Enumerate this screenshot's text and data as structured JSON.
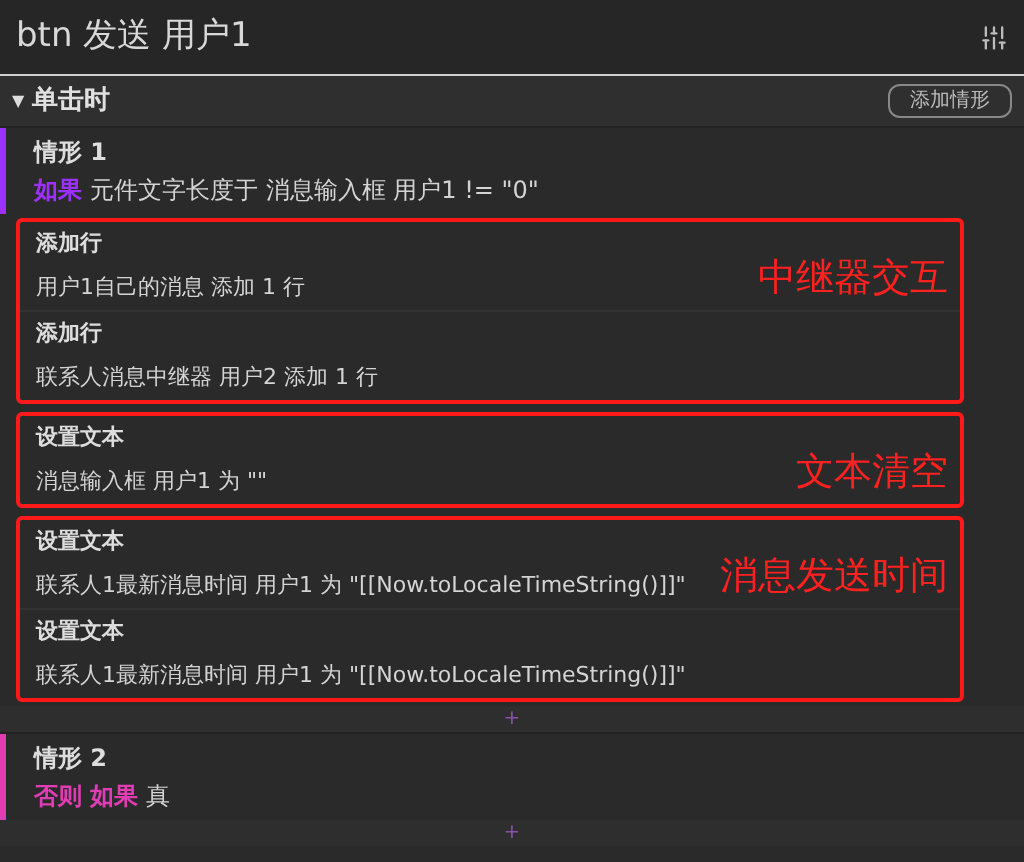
{
  "title": "btn 发送 用户1",
  "event": {
    "toggle": "▼",
    "label": "单击时",
    "expanded": true,
    "add_button": "添加情形"
  },
  "cases": [
    {
      "title": "情形 1",
      "color": "#9b30ff",
      "keyword": "如果",
      "condition": "元件文字长度于 消息输入框 用户1 != \"0\"",
      "add_mark": "+",
      "groups": [
        {
          "note": "中继器交互",
          "actions": [
            {
              "title": "添加行",
              "detail": "用户1自己的消息 添加 1 行"
            },
            {
              "title": "添加行",
              "detail": "联系人消息中继器 用户2 添加 1 行"
            }
          ]
        },
        {
          "note": "文本清空",
          "actions": [
            {
              "title": "设置文本",
              "detail": "消息输入框 用户1 为 \"\""
            }
          ]
        },
        {
          "note": "消息发送时间",
          "actions": [
            {
              "title": "设置文本",
              "detail": "联系人1最新消息时间 用户1 为 \"[[Now.toLocaleTimeString()]]\""
            },
            {
              "title": "设置文本",
              "detail": "联系人1最新消息时间 用户1 为 \"[[Now.toLocaleTimeString()]]\""
            }
          ]
        }
      ]
    },
    {
      "title": "情形 2",
      "color": "#e03cb4",
      "keyword": "否则 如果",
      "condition": "真",
      "add_mark": "+"
    }
  ]
}
